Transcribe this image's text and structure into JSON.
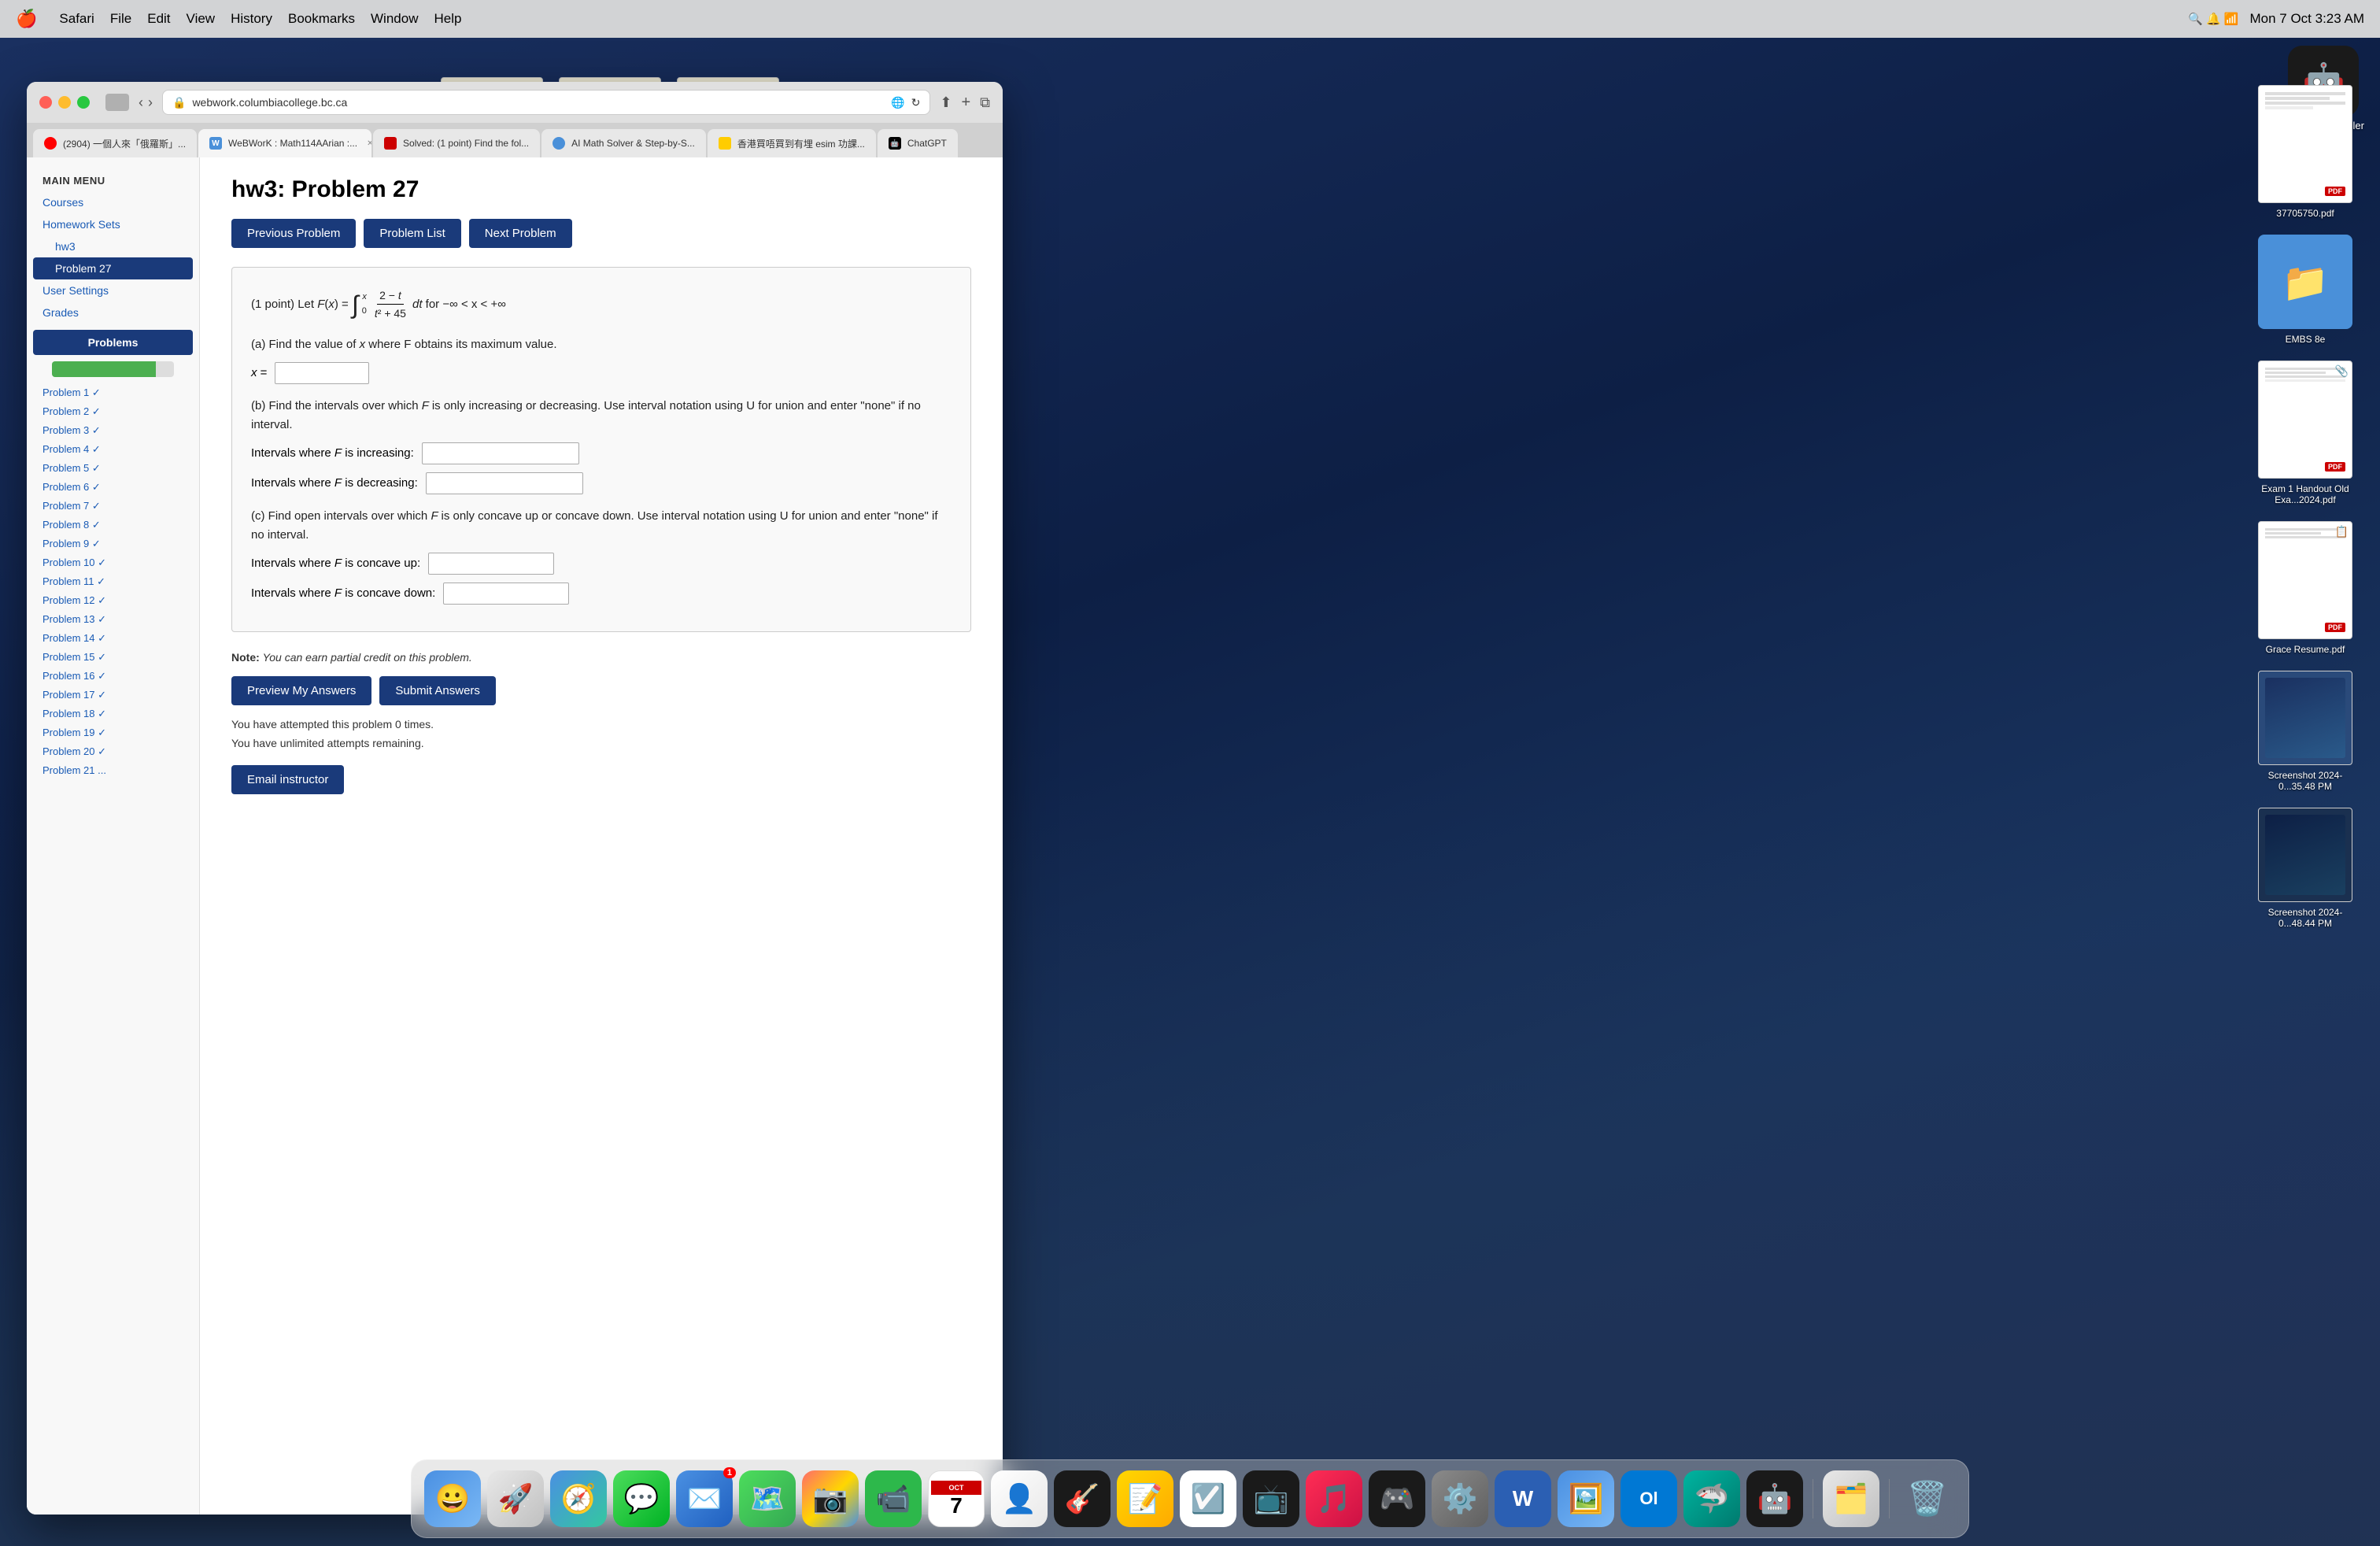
{
  "menubar": {
    "apple": "🍎",
    "items": [
      "Safari",
      "File",
      "Edit",
      "View",
      "History",
      "Bookmarks",
      "Window",
      "Help"
    ],
    "time": "Mon 7 Oct  3:23 AM"
  },
  "browser": {
    "address": "webwork.columbiacollege.bc.ca",
    "tabs": [
      {
        "label": "(2904) 一個人來「俄羅斯」...",
        "favicon_color": "#ff0000",
        "active": false
      },
      {
        "label": "WeBWorK : Math114AArian :...",
        "favicon_color": "#4a90d9",
        "active": true
      },
      {
        "label": "Solved: (1 point) Find the fol...",
        "favicon_color": "#cc0000",
        "active": false
      },
      {
        "label": "AI Math Solver & Step-by-S...",
        "favicon_color": "#4a90d9",
        "active": false
      },
      {
        "label": "香港買唔買到有埋 esim 功課...",
        "favicon_color": "#ffcc00",
        "active": false
      },
      {
        "label": "ChatGPT",
        "favicon_color": "#000",
        "active": false
      }
    ]
  },
  "sidebar": {
    "main_menu_label": "MAIN MENU",
    "courses_link": "Courses",
    "homework_sets_link": "Homework Sets",
    "hw3_link": "hw3",
    "problem27_link": "Problem 27",
    "user_settings_link": "User Settings",
    "grades_link": "Grades",
    "problems_header": "Problems",
    "problem_links": [
      "Problem 1 ✓",
      "Problem 2 ✓",
      "Problem 3 ✓",
      "Problem 4 ✓",
      "Problem 5 ✓",
      "Problem 6 ✓",
      "Problem 7 ✓",
      "Problem 8 ✓",
      "Problem 9 ✓",
      "Problem 10 ✓",
      "Problem 11 ✓",
      "Problem 12 ✓",
      "Problem 13 ✓",
      "Problem 14 ✓",
      "Problem 15 ✓",
      "Problem 16 ✓",
      "Problem 17 ✓",
      "Problem 18 ✓",
      "Problem 19 ✓",
      "Problem 20 ✓",
      "Problem 21 ..."
    ]
  },
  "main": {
    "page_title": "hw3: Problem 27",
    "btn_previous": "Previous Problem",
    "btn_list": "Problem List",
    "btn_next": "Next Problem",
    "problem_intro": "(1 point) Let",
    "problem_variable": "F(x) =",
    "problem_domain": "for −∞ < x < +∞",
    "part_a_label": "(a) Find the value of",
    "part_a_text": "where F obtains its maximum value.",
    "part_a_var": "x =",
    "part_b_label": "(b) Find the intervals over which",
    "part_b_text": "is only increasing or decreasing. Use interval notation using U for union and enter \"none\" if no interval.",
    "part_b_increasing_label": "Intervals where F is increasing:",
    "part_b_decreasing_label": "Intervals where F is decreasing:",
    "part_c_label": "(c) Find open intervals over which",
    "part_c_text": "is only concave up or concave down. Use interval notation using U for union and enter \"none\" if no interval.",
    "part_c_concave_up_label": "Intervals where F is concave up:",
    "part_c_concave_down_label": "Intervals where F is concave down:",
    "note_prefix": "Note:",
    "note_text": "You can earn partial credit on this problem.",
    "btn_preview": "Preview My Answers",
    "btn_submit": "Submit Answers",
    "attempt_line1": "You have attempted this problem 0 times.",
    "attempt_line2": "You have unlimited attempts remaining.",
    "btn_email": "Email instructor"
  },
  "desktop_icons": [
    {
      "label": "37705750.pdf",
      "type": "pdf"
    },
    {
      "label": "EMBS 8e",
      "type": "folder"
    },
    {
      "label": "Exam 1 Handout Old Exa...2024.pdf",
      "type": "pdf"
    },
    {
      "label": "Grace Resume.pdf",
      "type": "pdf"
    },
    {
      "label": "Screenshot 2024-0...35.48 PM",
      "type": "screenshot"
    },
    {
      "label": "Screenshot 2024-0...48.44 PM",
      "type": "screenshot"
    }
  ],
  "chatgpt_installer": {
    "label": "ChatGPT Installer"
  },
  "dock": {
    "items": [
      {
        "icon": "🔍",
        "label": "Finder"
      },
      {
        "icon": "🚀",
        "label": "Launchpad"
      },
      {
        "icon": "🧭",
        "label": "Safari"
      },
      {
        "icon": "💬",
        "label": "Messages"
      },
      {
        "icon": "✉️",
        "label": "Mail",
        "badge": "1"
      },
      {
        "icon": "🗺️",
        "label": "Maps"
      },
      {
        "icon": "📷",
        "label": "Photos"
      },
      {
        "icon": "📞",
        "label": "FaceTime"
      },
      {
        "icon": "📅",
        "label": "Calendar"
      },
      {
        "icon": "💼",
        "label": "Contacts"
      },
      {
        "icon": "🎵",
        "label": "GarageBand"
      },
      {
        "icon": "📝",
        "label": "Notes"
      },
      {
        "icon": "📋",
        "label": "Reminders"
      },
      {
        "icon": "📺",
        "label": "TV"
      },
      {
        "icon": "🎵",
        "label": "Music"
      },
      {
        "icon": "🎮",
        "label": "Arcade"
      },
      {
        "icon": "⚙️",
        "label": "System Prefs"
      },
      {
        "icon": "W",
        "label": "Word"
      },
      {
        "icon": "🖼️",
        "label": "Preview"
      },
      {
        "icon": "📊",
        "label": "Outlook"
      },
      {
        "icon": "🌲",
        "label": "Surfshark"
      },
      {
        "icon": "🤖",
        "label": "ChatGPT"
      },
      {
        "icon": "🗂️",
        "label": "Files"
      },
      {
        "icon": "🗑️",
        "label": "Trash"
      }
    ]
  }
}
